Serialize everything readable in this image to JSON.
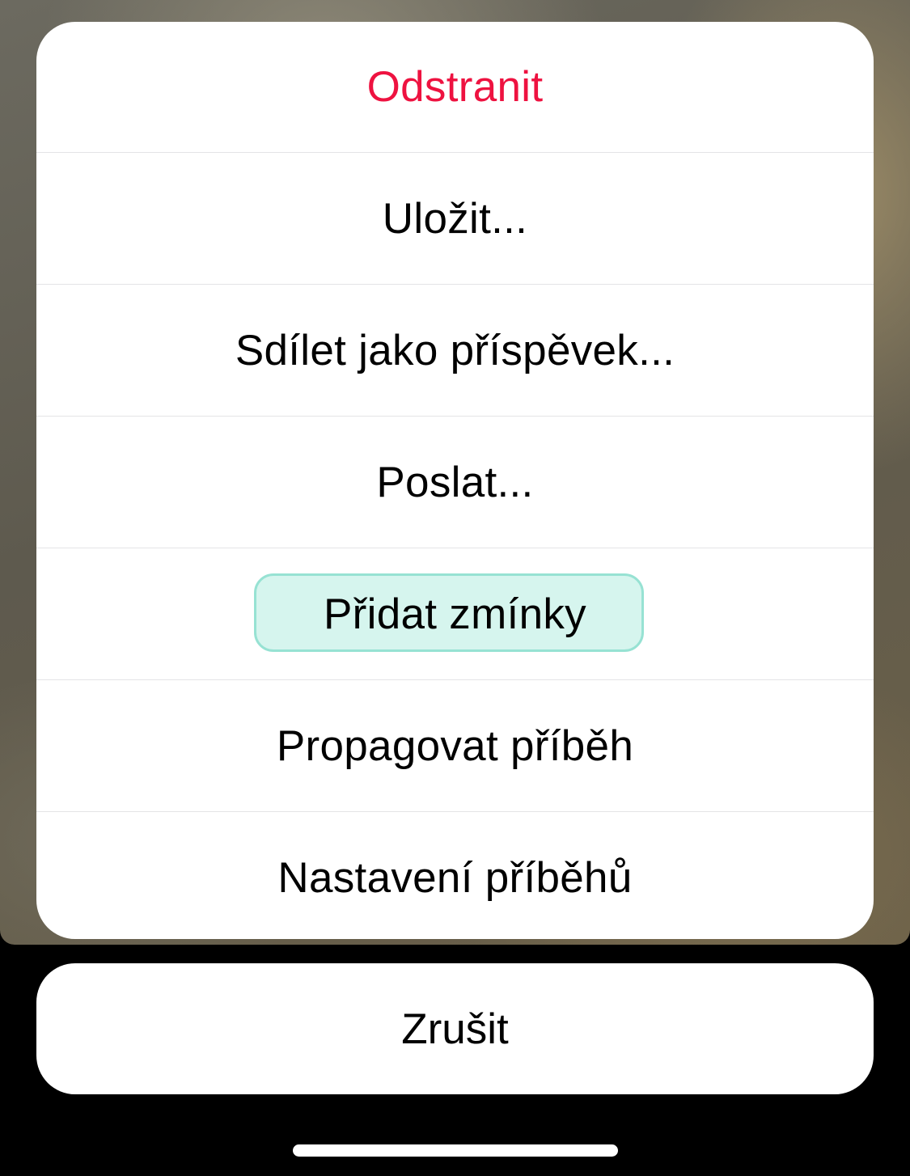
{
  "action_sheet": {
    "items": [
      {
        "label": "Odstranit",
        "style": "destructive",
        "color": "#ee1240"
      },
      {
        "label": "Uložit..."
      },
      {
        "label": "Sdílet jako příspěvek..."
      },
      {
        "label": "Poslat..."
      },
      {
        "label": "Přidat zmínky",
        "highlighted": true,
        "highlight_color": "#d6f5ee"
      },
      {
        "label": "Propagovat příběh"
      },
      {
        "label": "Nastavení příběhů"
      }
    ],
    "cancel_label": "Zrušit"
  }
}
